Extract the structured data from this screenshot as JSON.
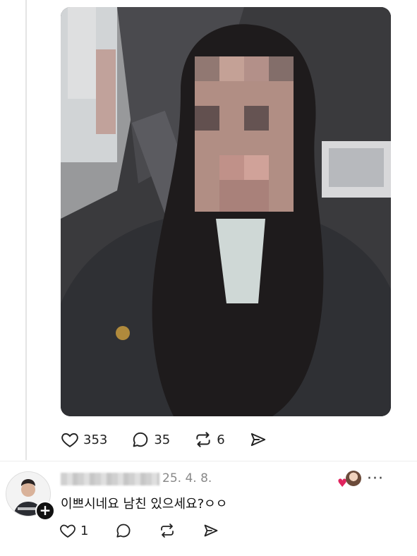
{
  "post": {
    "image_alt": "Selfie photo with blurred face",
    "actions": {
      "like_count": "353",
      "comment_count": "35",
      "repost_count": "6"
    }
  },
  "comment": {
    "date": "25. 4. 8.",
    "text": "이쁘시네요 남친 있으세요?ㅇㅇ",
    "actions": {
      "like_count": "1"
    }
  },
  "colors": {
    "heart_liked": "#e0245e",
    "muted_text": "#888888"
  },
  "icons": [
    "heart-icon",
    "comment-icon",
    "repost-icon",
    "share-icon",
    "more-icon",
    "plus-icon"
  ]
}
